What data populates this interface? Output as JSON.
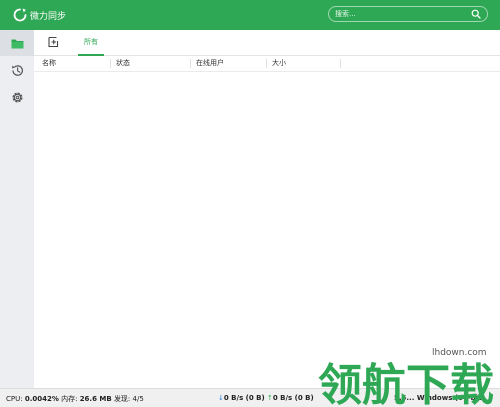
{
  "titlebar": {
    "app_title": "微力同步",
    "search_placeholder": "搜索..."
  },
  "toolbar": {
    "tab_all": "所有"
  },
  "table": {
    "columns": [
      "名称",
      "状态",
      "在线用户",
      "大小"
    ]
  },
  "statusbar": {
    "cpu_label": "CPU:",
    "cpu_value": "0.0042%",
    "memory_label": "内存:",
    "memory_value": "26.6 MB",
    "discovered_label": "发现:",
    "discovered_value": "4/5",
    "download": "0 B/s (0 B)",
    "upload": "0 B/s (0 B)",
    "version_info": "5.5... Windows (64-bit)"
  },
  "watermark": {
    "url": "lhdown.com"
  },
  "colors": {
    "accent": "#2fa855",
    "sidebar_bg": "#eceef1",
    "status_bg": "#f0f0f0"
  },
  "icons": {
    "logo": "sync-logo-icon",
    "search": "search-icon",
    "folders": "folder-icon",
    "history": "history-icon",
    "settings": "gear-icon",
    "add": "add-folder-icon"
  }
}
